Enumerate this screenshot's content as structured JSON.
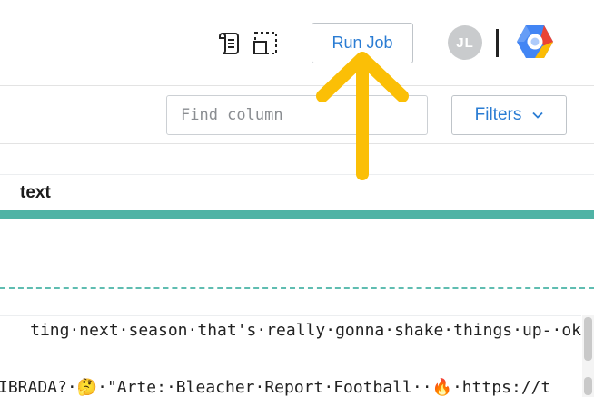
{
  "header": {
    "recipe_icon": "recipe-scroll-icon",
    "sample_icon": "sample-selection-icon",
    "run_job_label": "Run Job",
    "avatar_initials": "JL",
    "logo": "google-cloud-hexagon-logo"
  },
  "toolbar": {
    "find_placeholder": "Find column",
    "find_value": "",
    "filters_label": "Filters",
    "filters_icon": "chevron-down-icon"
  },
  "grid": {
    "column_header": "text",
    "quality_bar_color": "#4fb3a5",
    "rows": [
      "ting·next·season·that's·really·gonna·shake·things·up-·ok",
      "IBRADA?·🤔·\"Arte:·Bleacher·Report·Football··🔥·https://t"
    ]
  },
  "annotation": {
    "arrow_color": "#fbbf06",
    "arrow_target": "run-job-button"
  }
}
